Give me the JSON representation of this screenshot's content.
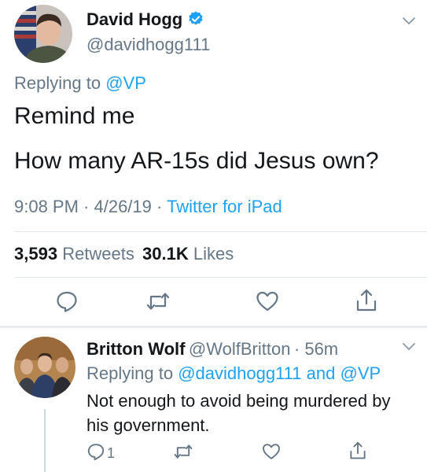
{
  "main_tweet": {
    "author_name": "David Hogg",
    "author_handle": "@davidhogg111",
    "verified": true,
    "replying_prefix": "Replying to",
    "replying_to": "@VP",
    "text_line1": "Remind me",
    "text_line2": "How many AR-15s did Jesus own?",
    "time_date": "9:08 PM · 4/26/19 ·",
    "source": "Twitter for iPad",
    "retweets_count": "3,593",
    "retweets_label": "Retweets",
    "likes_count": "30.1K",
    "likes_label": "Likes"
  },
  "reply_tweet": {
    "author_name": "Britton Wolf",
    "author_handle": "@WolfBritton",
    "time": "· 56m",
    "replying_prefix": "Replying to",
    "replying_to_1": "@davidhogg111",
    "replying_and": "and",
    "replying_to_2": "@VP",
    "text": "Not enough to avoid being murdered by his government.",
    "reply_count": "1"
  },
  "icons": {
    "verified": "verified-badge-icon",
    "more": "chevron-down-icon",
    "reply": "reply-bubble-icon",
    "retweet": "retweet-icon",
    "like": "heart-icon",
    "share": "share-icon"
  },
  "colors": {
    "accent": "#1da1f2",
    "secondary_text": "#657786",
    "primary_text": "#14171a",
    "divider": "#e1e8ed"
  }
}
